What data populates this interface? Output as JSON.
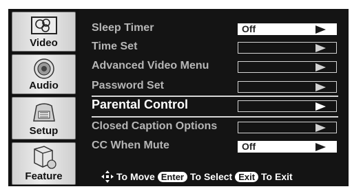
{
  "tabs": [
    {
      "label": "Video",
      "icon": "video-icon"
    },
    {
      "label": "Audio",
      "icon": "speaker-icon"
    },
    {
      "label": "Setup",
      "icon": "setup-icon"
    },
    {
      "label": "Feature",
      "icon": "feature-icon"
    }
  ],
  "active_tab": "Feature",
  "menu": {
    "items": [
      {
        "label": "Sleep Timer",
        "value": "Off"
      },
      {
        "label": "Time Set",
        "value": ""
      },
      {
        "label": "Advanced Video Menu",
        "value": ""
      },
      {
        "label": "Password Set",
        "value": ""
      },
      {
        "label": "Parental Control",
        "value": ""
      },
      {
        "label": "Closed Caption Options",
        "value": ""
      },
      {
        "label": "CC When Mute",
        "value": "Off"
      }
    ],
    "selected": "Parental Control"
  },
  "footer": {
    "move_text": "To Move",
    "enter_key": "Enter",
    "select_text": "To Select",
    "exit_key": "Exit",
    "exit_text": "To Exit"
  },
  "colors": {
    "panel_bg": "#141414",
    "label_gray": "#b6b6b6",
    "selected_white": "#ffffff",
    "tab_silver": "#e0e0e0"
  }
}
